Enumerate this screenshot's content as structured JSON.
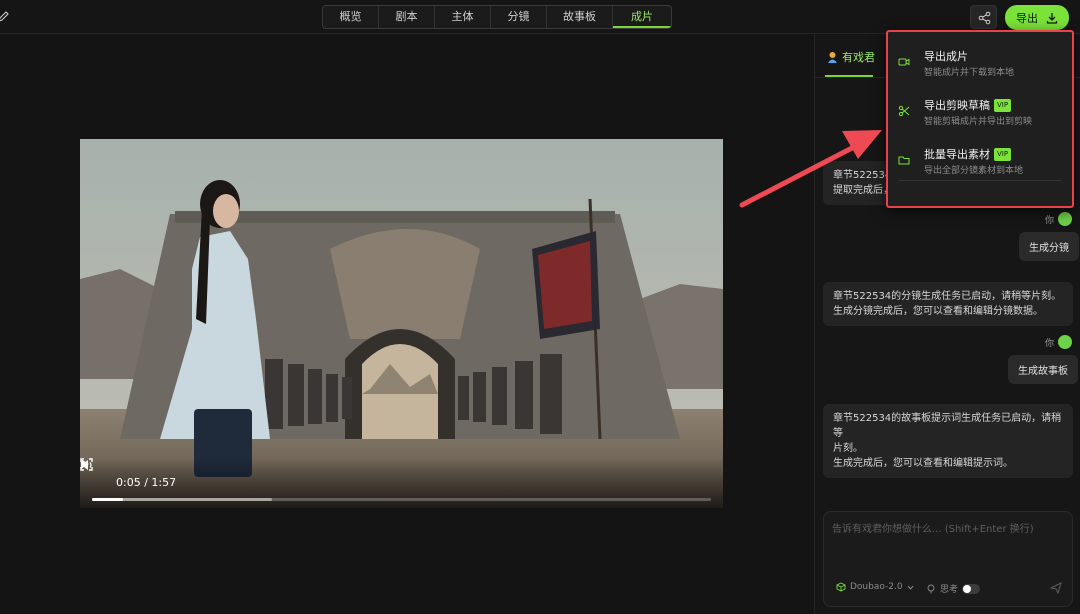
{
  "topbar": {
    "tabs": [
      {
        "label": "概览",
        "w": 56
      },
      {
        "label": "剧本",
        "w": 56
      },
      {
        "label": "主体",
        "w": 56
      },
      {
        "label": "分镜",
        "w": 56
      },
      {
        "label": "故事板",
        "w": 66
      },
      {
        "label": "成片",
        "w": 58
      }
    ],
    "active_tab": "成片",
    "export_label": "导出"
  },
  "video": {
    "time": "0:05 / 1:57",
    "progress": 0.05,
    "buffered": 0.29
  },
  "panel": {
    "tab_label": "有戏君",
    "messages": {
      "ai1_line1": "章节522534",
      "ai1_line2": "提取完成后，主体数据将自动更新。",
      "you_label": "你",
      "user1": "生成分镜",
      "ai2_line1": "章节522534的分镜生成任务已启动，请稍等片刻。",
      "ai2_line2": "生成分镜完成后，您可以查看和编辑分镜数据。",
      "user2": "生成故事板",
      "ai3_line1": "章节522534的故事板提示词生成任务已启动，请稍等",
      "ai3_line2": "片刻。",
      "ai3_line3": "生成完成后，您可以查看和编辑提示词。"
    },
    "input_placeholder": "告诉有戏君你想做什么... (Shift+Enter 换行)",
    "model": "Doubao-2.0",
    "think_label": "思考"
  },
  "dropdown": {
    "items": [
      {
        "title": "导出成片",
        "subtitle": "智能成片并下载到本地",
        "vip": false
      },
      {
        "title": "导出剪映草稿",
        "subtitle": "智能剪辑成片并导出到剪映",
        "vip": true
      },
      {
        "title": "批量导出素材",
        "subtitle": "导出全部分镜素材到本地",
        "vip": true
      }
    ],
    "vip_label": "VIP"
  },
  "colors": {
    "accent": "#7be23a",
    "highlight_border": "#e8424a",
    "background": "#151515"
  }
}
